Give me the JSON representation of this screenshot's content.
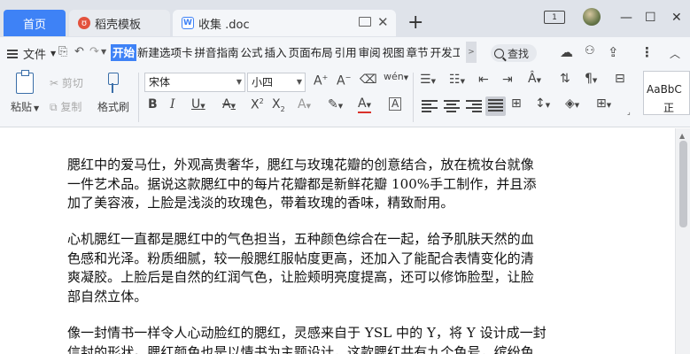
{
  "tabs": {
    "home": "首页",
    "daoke": "稻壳模板",
    "doc": "收集 .doc",
    "close": "✕",
    "add": "+"
  },
  "window": {
    "badge": "1",
    "minimize": "—",
    "maximize": "☐",
    "close": "✕"
  },
  "menu": {
    "file": "文件",
    "tabs": [
      "开始",
      "新建选项卡",
      "拼音指南",
      "公式",
      "插入",
      "页面布局",
      "引用",
      "审阅",
      "视图",
      "章节",
      "开发工"
    ],
    "search": "查找"
  },
  "ribbon": {
    "paste": "粘贴",
    "cut": "剪切",
    "copy": "复制",
    "format_painter": "格式刷",
    "font": "宋体",
    "size": "小四",
    "style1": "AaBbC",
    "style2": "正"
  },
  "document": {
    "p1_lines": [
      "腮红中的爱马仕，外观高贵奢华，腮红与玫瑰花瓣的创意结合，放在梳妆台就像",
      "一件艺术品。据说这款腮红中的每片花瓣都是新鲜花瓣 100%手工制作，并且添",
      "加了美容液，上脸是浅淡的玫瑰色，带着玫瑰的香味，精致耐用。"
    ],
    "p2_lines": [
      "心机腮红一直都是腮红中的气色担当，五种颜色综合在一起，给予肌肤天然的血",
      "色感和光泽。粉质细腻，较一般腮红服帖度更高，还加入了能配合表情变化的清",
      "爽凝胶。上脸后是自然的红润气色，让脸颊明亮度提高，还可以修饰脸型，让脸",
      "部自然立体。"
    ],
    "p3_lines": [
      "像一封情书一样令人心动脸红的腮红，灵感来自于 YSL 中的 Y，将 Y 设计成一封",
      "信封的形状。腮红颜色也是以情书为主题设计，这款腮红共有九个色号，缤纷色"
    ]
  }
}
